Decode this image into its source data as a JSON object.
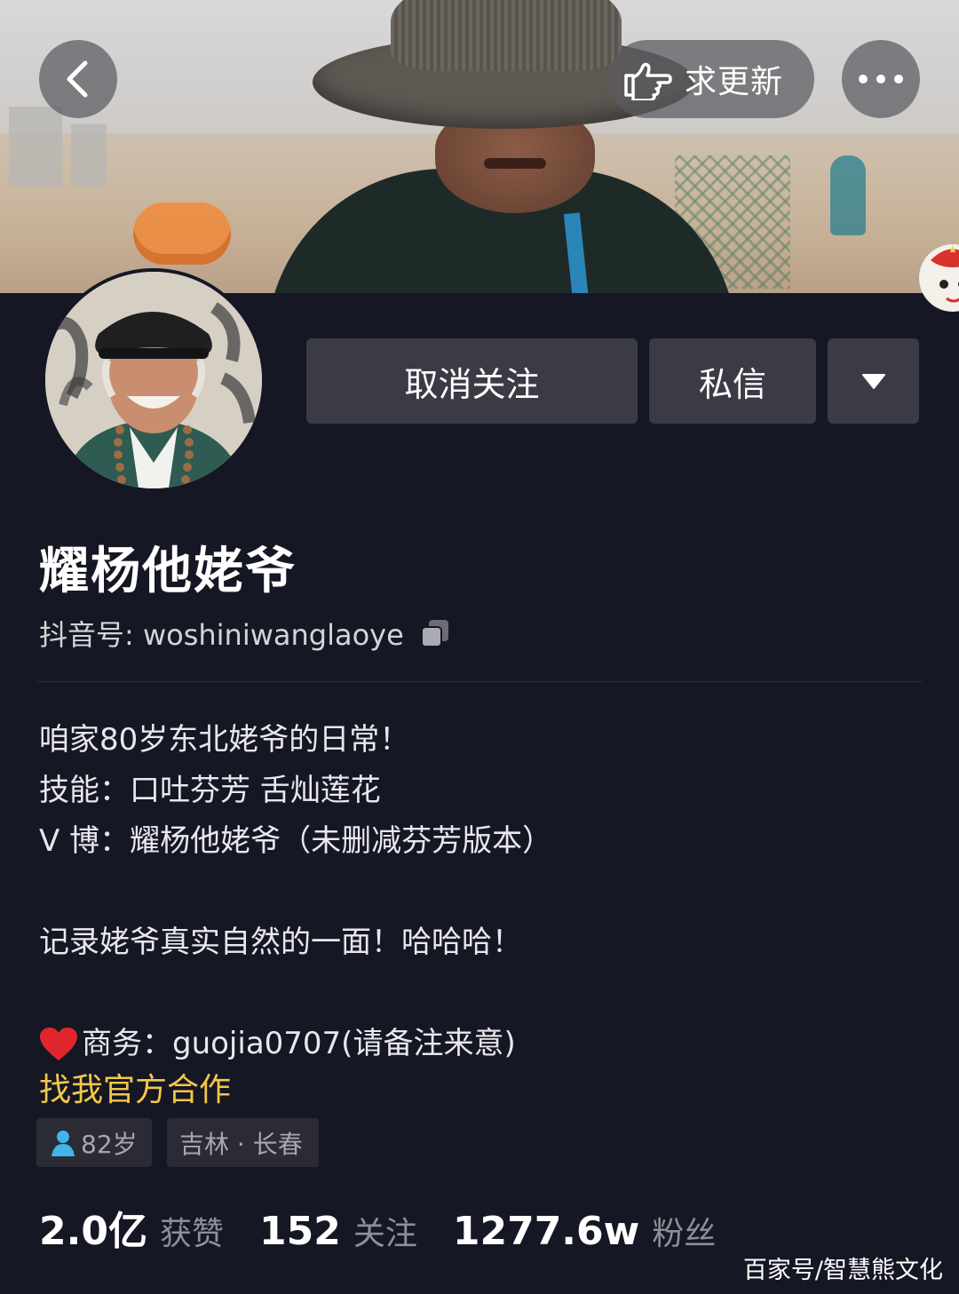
{
  "header": {
    "update_label": "求更新"
  },
  "actions": {
    "unfollow_label": "取消关注",
    "message_label": "私信"
  },
  "profile": {
    "name": "耀杨他姥爷",
    "douyin_id": "抖音号: woshiniwanglaoye"
  },
  "bio": {
    "line1": "咱家80岁东北姥爷的日常！",
    "line2": "技能：口吐芬芳 舌灿莲花",
    "line3": "V 博：耀杨他姥爷（未删减芬芳版本）",
    "line4": "记录姥爷真实自然的一面！哈哈哈！",
    "business": "商务：guojia0707(请备注来意)"
  },
  "official_link": "找我官方合作",
  "tags": {
    "age": "82岁",
    "location": "吉林 · 长春"
  },
  "stats": [
    {
      "value": "2.0亿",
      "label": "获赞"
    },
    {
      "value": "152",
      "label": "关注"
    },
    {
      "value": "1277.6w",
      "label": "粉丝"
    }
  ],
  "watermark": "百家号/智慧熊文化",
  "colors": {
    "background": "#161724",
    "button": "#3a3b45",
    "accent_link": "#f2c84b",
    "heart": "#e0262c",
    "age_icon": "#3fb6e6"
  },
  "icons": {
    "back": "chevron-left-icon",
    "update": "pointing-hand-icon",
    "more": "more-dots-icon",
    "dropdown": "triangle-down-icon",
    "copy": "copy-icon",
    "heart": "heart-icon",
    "age": "person-icon"
  }
}
